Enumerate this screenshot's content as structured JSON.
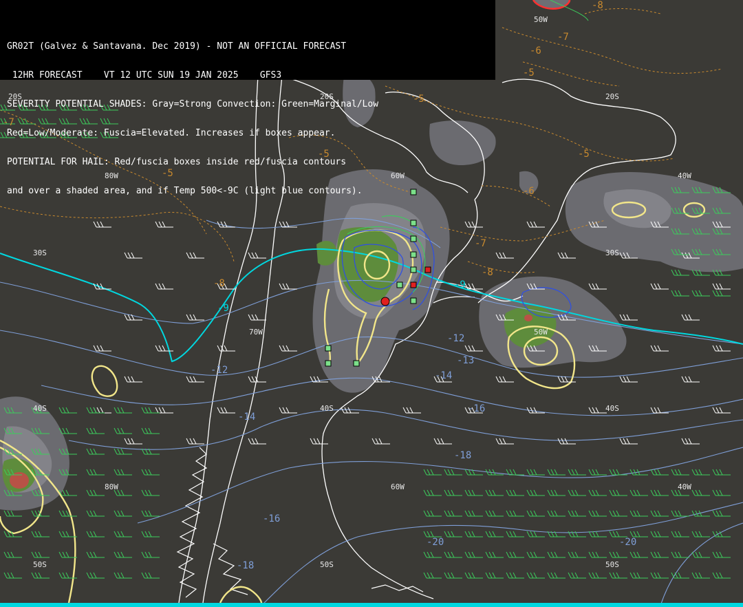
{
  "header": {
    "line1": "GR02T (Galvez & Santavana. Dec 2019) - NOT AN OFFICIAL FORECAST",
    "line2": " 12HR FORECAST    VT 12 UTC SUN 19 JAN 2025    GFS3",
    "line3": "SEVERITY POTENTIAL SHADES: Gray=Strong Convection: Green=Marginal/Low",
    "line4": "Red=Low/Moderate: Fuscia=Elevated. Increases if boxes appear.",
    "line5": "POTENTIAL FOR HAIL: Red/fuscia boxes inside red/fuscia contours",
    "line6": "and over a shaded area, and if Temp 500<-9C (light blue contours)."
  },
  "grid_labels": {
    "lat_20s_a": "20S",
    "lat_20s_b": "20S",
    "lat_20s_c": "20S",
    "lat_30s_a": "30S",
    "lat_30s_b": "30S",
    "lat_40s_a": "40S",
    "lat_40s_b": "40S",
    "lat_40s_c": "40S",
    "lat_50s_a": "50S",
    "lat_50s_b": "50S",
    "lat_50s_c": "50S",
    "lon_80w_a": "80W",
    "lon_80w_b": "80W",
    "lon_60w_a": "60W",
    "lon_60w_b": "60W",
    "lon_40w_a": "40W",
    "lon_40w_b": "40W",
    "lon_50w_a": "50W",
    "lon_50w_b": "50W",
    "lon_70w_a": "70W"
  },
  "temp_labels": {
    "t_m9_a": "-9",
    "t_m9_b": "-9",
    "t_m12_a": "-12",
    "t_m12_b": "-12",
    "t_m13": "-13",
    "t_m14_a": "-14",
    "t_m14_b": "-14",
    "t_m16_a": "-16",
    "t_m16_b": "-16",
    "t_m18_a": "-18",
    "t_m18_b": "-18",
    "t_m20_a": "-20",
    "t_m20_b": "-20"
  },
  "thickness_labels": {
    "o1": "-8",
    "o2": "-7",
    "o3": "-6",
    "o4": "-5",
    "o5": "-5",
    "o6": "-5",
    "o7": "-5",
    "o8": "-5",
    "o9": "-6",
    "o10": "-7",
    "o11": "-8",
    "o12": "-8",
    "o13": "-7"
  },
  "colors": {
    "background": "#3b3a36",
    "gray_shade": "#6e6e74",
    "gray_light": "#8a8a90",
    "green_shade": "#5e8c3c",
    "red_shade": "#c84848",
    "yellow_contour": "#f2e68a",
    "cyan_contour": "#00d8e0",
    "blue_contour": "#7f9fd8",
    "orange_contour": "#c98a2e",
    "coast": "#ffffff"
  }
}
